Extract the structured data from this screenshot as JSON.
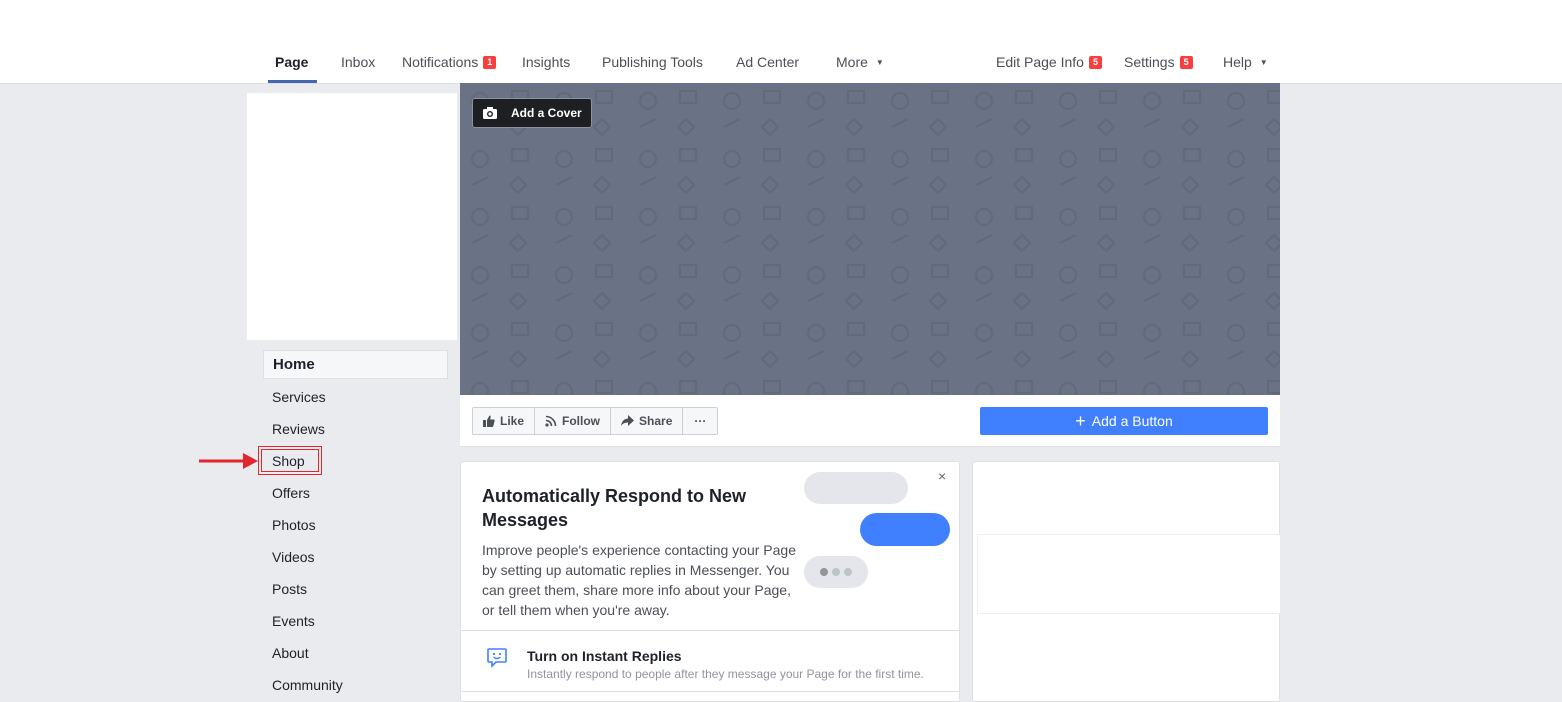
{
  "nav": {
    "tabs": [
      {
        "label": "Page"
      },
      {
        "label": "Inbox"
      },
      {
        "label": "Notifications",
        "badge": "1"
      },
      {
        "label": "Insights"
      },
      {
        "label": "Publishing Tools"
      },
      {
        "label": "Ad Center"
      },
      {
        "label": "More"
      }
    ],
    "right": [
      {
        "label": "Edit Page Info",
        "badge": "5"
      },
      {
        "label": "Settings",
        "badge": "5"
      },
      {
        "label": "Help"
      }
    ]
  },
  "sidebar": {
    "items": [
      {
        "label": "Home",
        "active": true
      },
      {
        "label": "Services"
      },
      {
        "label": "Reviews"
      },
      {
        "label": "Shop",
        "highlighted": true
      },
      {
        "label": "Offers"
      },
      {
        "label": "Photos"
      },
      {
        "label": "Videos"
      },
      {
        "label": "Posts"
      },
      {
        "label": "Events"
      },
      {
        "label": "About"
      },
      {
        "label": "Community"
      }
    ]
  },
  "cover": {
    "add_cover_label": "Add a Cover",
    "icon": "camera-icon"
  },
  "actions": {
    "like_label": "Like",
    "follow_label": "Follow",
    "share_label": "Share",
    "more_label": "···",
    "add_button_label": "Add a Button"
  },
  "auto_respond": {
    "title": "Automatically Respond to New Messages",
    "description": "Improve people's experience contacting your Page by setting up automatic replies in Messenger. You can greet them, share more info about your Page, or tell them when you're away.",
    "close_label": "×",
    "instant_title": "Turn on Instant Replies",
    "instant_subtitle": "Instantly respond to people after they message your Page for the first time."
  },
  "colors": {
    "brand_blue": "#4267b2",
    "button_blue": "#4080ff",
    "badge_red": "#fa3e3e",
    "annotation_red": "#e0262f",
    "cover_gray": "#6a7285"
  }
}
